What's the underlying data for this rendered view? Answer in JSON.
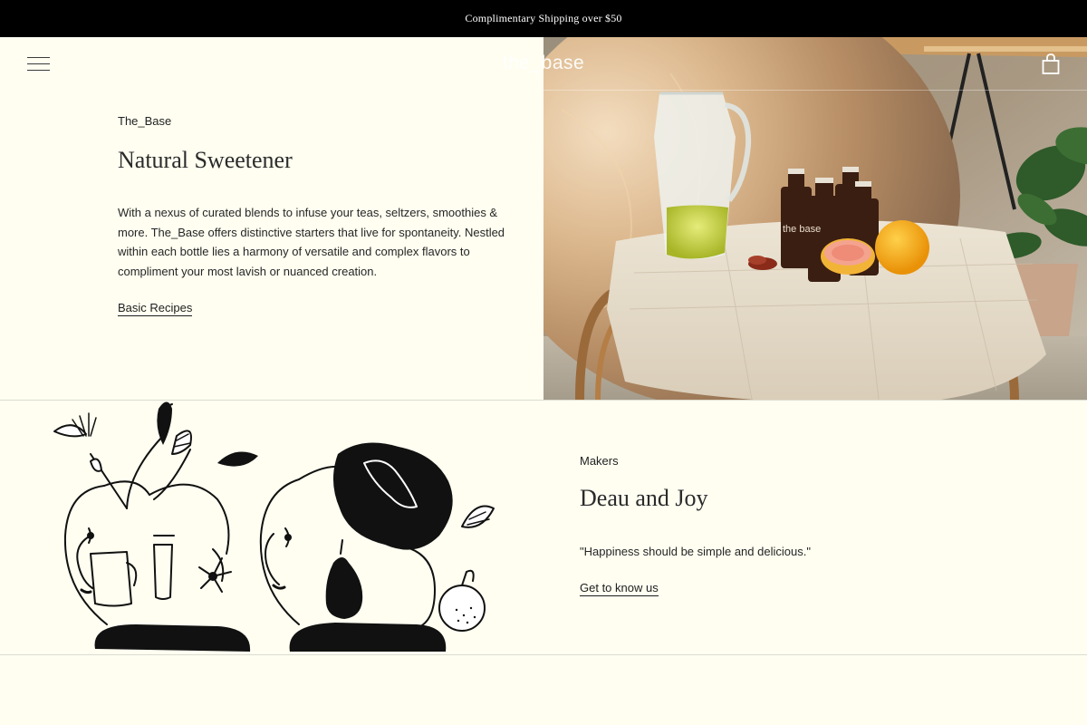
{
  "announcement": {
    "text": "Complimentary Shipping over $50"
  },
  "header": {
    "logo_text": "the_base",
    "menu_icon": "hamburger-menu-icon",
    "cart_icon": "shopping-bag-icon"
  },
  "feature": {
    "eyebrow": "The_Base",
    "title": "Natural Sweetener",
    "body": "With a nexus of curated blends to infuse your teas, seltzers, smoothies & more. The_Base offers distinctive starters that live for spontaneity. Nestled within each bottle lies a harmony of versatile and complex flavors to compliment your most lavish or nuanced creation.",
    "link_label": "Basic Recipes",
    "image_label": "the base"
  },
  "makers": {
    "eyebrow": "Makers",
    "title": "Deau and Joy",
    "quote": "\"Happiness should be simple and delicious.\"",
    "link_label": "Get to know us"
  },
  "colors": {
    "background": "#fffef1",
    "announcement_bg": "#000000",
    "text": "#1f1f1f"
  }
}
